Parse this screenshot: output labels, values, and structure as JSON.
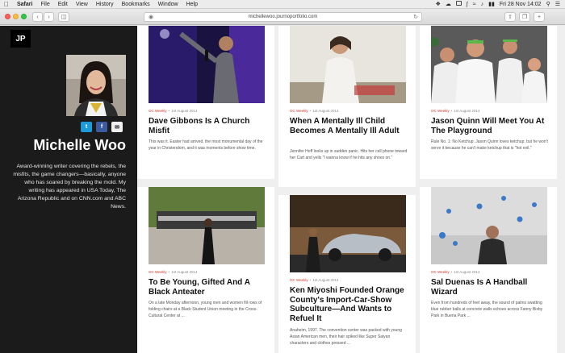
{
  "menubar": {
    "app": "Safari",
    "items": [
      "File",
      "Edit",
      "View",
      "History",
      "Bookmarks",
      "Window",
      "Help"
    ],
    "clock": "Fri 28 Nov  14:02"
  },
  "browser": {
    "url": "michellewoo.journoportfolio.com"
  },
  "sidebar": {
    "logo": "JP",
    "name": "Michelle Woo",
    "social": {
      "twitter": "t",
      "facebook": "f",
      "email": "✉"
    },
    "bio": "Award-winning writer covering the rebels, the misfits, the game changers—basically, anyone who has soared by breaking the mold. My writing has appeared in USA Today, The Arizona Republic and on CNN.com and ABC News."
  },
  "articles": [
    {
      "source": "OC Weekly",
      "date": "1st August 2014",
      "title": "Dave Gibbons Is A Church Misfit",
      "excerpt": "This was it. Easter had arrived, the most monumental day of the year in Christendom, and it was moments before show time."
    },
    {
      "source": "OC Weekly",
      "date": "1st August 2014",
      "title": "When A Mentally Ill Child Becomes A Mentally Ill Adult",
      "excerpt": "Jennifer Hoff looks up in sudden panic. Hits her cell phone toward her Cart and yells \"I wanna know if he hits any shoes on.\""
    },
    {
      "source": "OC Weekly",
      "date": "1st August 2014",
      "title": "Jason Quinn Will Meet You At The Playground",
      "excerpt": "Rule No. 1: No Ketchup. Jason Quinn loves ketchup, but he won't serve it because he can't make ketchup that is \"hot evil.\""
    },
    {
      "source": "OC Weekly",
      "date": "1st August 2014",
      "title": "To Be Young, Gifted And A Black Anteater",
      "excerpt": "On a late Monday afternoon, young men and women fill rows of folding chairs at a Black Student Union meeting in the Cross-Cultural Center at ..."
    },
    {
      "source": "OC Weekly",
      "date": "1st August 2014",
      "title": "Ken Miyoshi Founded Orange County's Import-Car-Show Subculture—And Wants to Refuel It",
      "excerpt": "Anaheim, 1997. The convention center was packed with young Asian American men, their hair spiked like Super Saiyan characters and clothes pressed ..."
    },
    {
      "source": "OC Weekly",
      "date": "1st August 2014",
      "title": "Sal Duenas Is A Handball Wizard",
      "excerpt": "Even from hundreds of feet away, the sound of palms swatting blue rubber balls at concrete walls echoes across Fanny Bixby Park in Buena Park ..."
    }
  ]
}
